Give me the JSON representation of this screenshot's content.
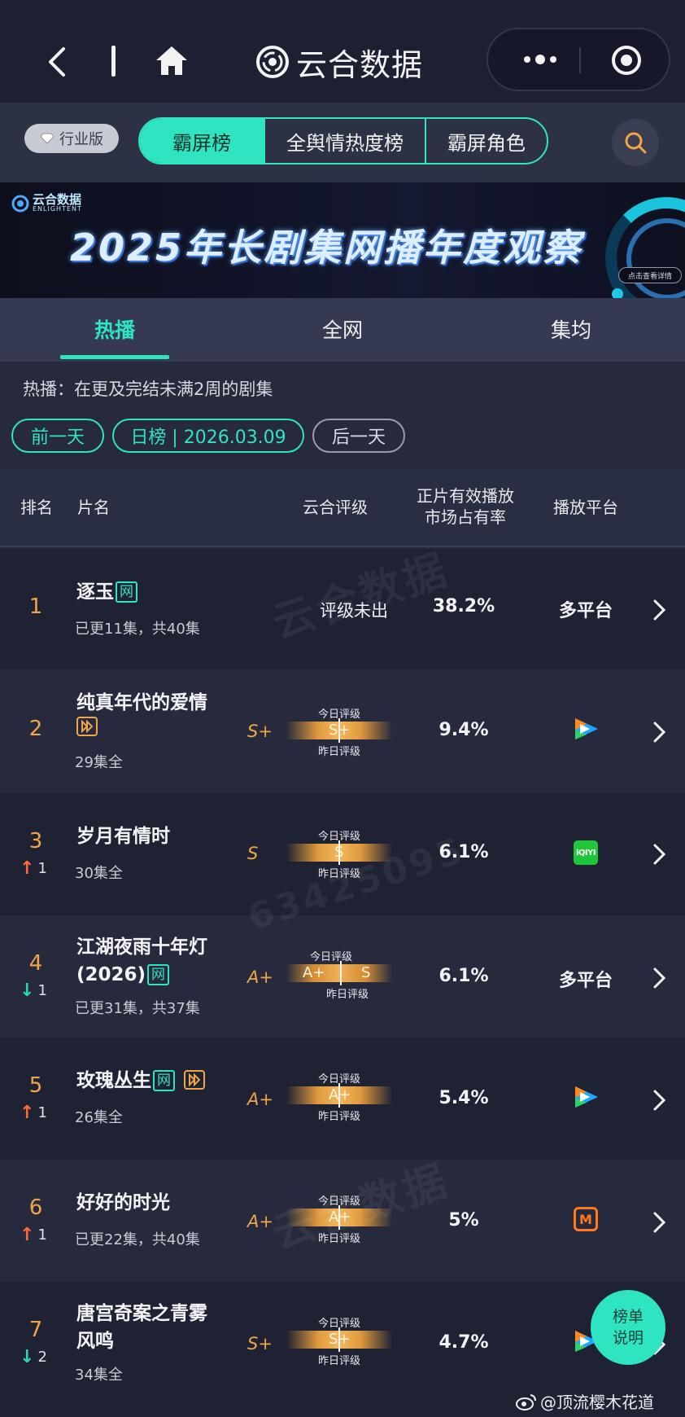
{
  "nav": {
    "brand": "云合数据"
  },
  "tabs": {
    "edition": "行业版",
    "items": [
      "霸屏榜",
      "全舆情热度榜",
      "霸屏角色"
    ]
  },
  "banner": {
    "logo": "云合数据",
    "logo_sub": "ENLIGHTENT",
    "title": "2025年长剧集网播年度观察",
    "cta": "点击查看详情"
  },
  "subtabs": [
    "热播",
    "全网",
    "集均"
  ],
  "description": "热播：在更及完结未满2周的剧集",
  "date_nav": {
    "prev": "前一天",
    "current": "日榜 | 2026.03.09",
    "next": "后一天"
  },
  "table_header": {
    "rank": "排名",
    "name": "片名",
    "grade": "云合评级",
    "share_l1": "正片有效播放",
    "share_l2": "市场占有率",
    "platform": "播放平台"
  },
  "gauge_labels": {
    "today": "今日评级",
    "yesterday": "昨日评级"
  },
  "rows": [
    {
      "rank": "1",
      "title": "逐玉",
      "tags": [
        "网"
      ],
      "episodes": "已更11集，共40集",
      "grade": "",
      "rating_text": "评级未出",
      "share": "38.2%",
      "platform": "多平台"
    },
    {
      "rank": "2",
      "title": "纯真年代的爱情",
      "tags": [
        "play"
      ],
      "episodes": "29集全",
      "grade": "S+",
      "today": "S+",
      "share": "9.4%",
      "platform_icon": "tencent-video-icon"
    },
    {
      "rank": "3",
      "trend": "up",
      "change": "1",
      "title": "岁月有情时",
      "tags": [],
      "episodes": "30集全",
      "grade": "S",
      "today": "S",
      "share": "6.1%",
      "platform_icon": "iqiyi-icon",
      "platform_logo": "iQIYI"
    },
    {
      "rank": "4",
      "trend": "down",
      "change": "1",
      "title_l1": "江湖夜雨十年灯",
      "title_l2": "(2026)",
      "tags": [
        "网"
      ],
      "episodes": "已更31集，共37集",
      "grade": "A+",
      "today": "A+",
      "yesterday": "S",
      "share": "6.1%",
      "platform": "多平台"
    },
    {
      "rank": "5",
      "trend": "up",
      "change": "1",
      "title": "玫瑰丛生",
      "tags": [
        "网",
        "play"
      ],
      "episodes": "26集全",
      "grade": "A+",
      "today": "A+",
      "share": "5.4%",
      "platform_icon": "tencent-video-icon"
    },
    {
      "rank": "6",
      "trend": "up",
      "change": "1",
      "title": "好好的时光",
      "tags": [],
      "episodes": "已更22集，共40集",
      "grade": "A+",
      "today": "A+",
      "share": "5%",
      "platform_icon": "mango-tv-icon",
      "platform_logo": "M"
    },
    {
      "rank": "7",
      "trend": "down",
      "change": "2",
      "title_l1": "唐宫奇案之青雾",
      "title_l2": "风鸣",
      "tags": [],
      "episodes": "34集全",
      "grade": "S+",
      "today": "S+",
      "share": "4.7%",
      "platform_icon": "tencent-video-icon"
    }
  ],
  "float_button": {
    "l1": "榜单",
    "l2": "说明"
  },
  "watermark": {
    "brand": "云合数据",
    "brand_sub": "ENLIGHTENT",
    "number": "63425095"
  },
  "weibo_credit": "@顶流樱木花道",
  "colors": {
    "accent": "#2fe4c0",
    "gold": "#f0a548",
    "up": "#ff6a3a",
    "down": "#29d8a8"
  }
}
